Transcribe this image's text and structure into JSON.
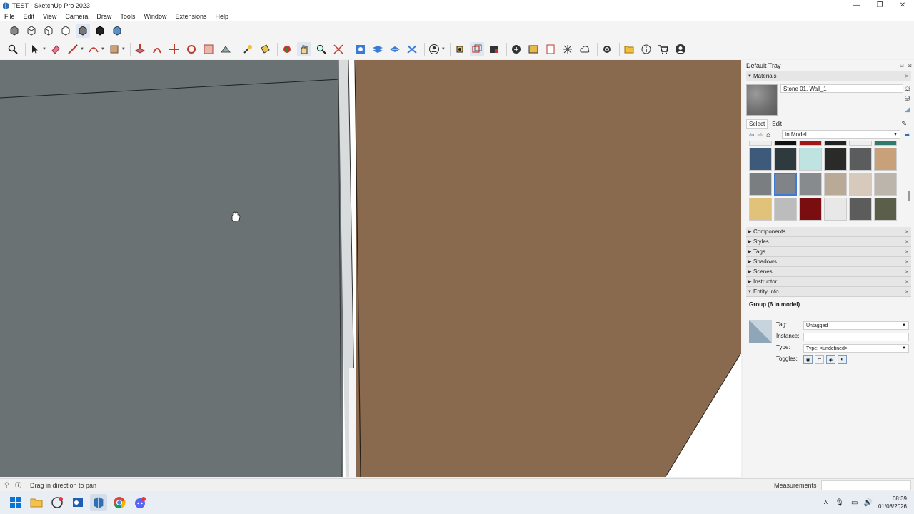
{
  "window": {
    "title": "TEST - SketchUp Pro 2023",
    "controls": [
      "—",
      "❐",
      "✕"
    ]
  },
  "menu": [
    "File",
    "Edit",
    "View",
    "Camera",
    "Draw",
    "Tools",
    "Window",
    "Extensions",
    "Help"
  ],
  "toolbar_top": [
    "iso-view-icon",
    "top-view-icon",
    "front-view-icon",
    "right-view-icon",
    "back-view-icon",
    "left-view-icon",
    "bottom-view-icon"
  ],
  "toolbar_main": [
    "search-icon",
    "select-icon",
    "eraser-icon",
    "line-icon",
    "arc-icon",
    "shapes-icon",
    "push-pull-icon",
    "offset-icon",
    "move-icon",
    "rotate-icon",
    "scale-icon",
    "follow-me-icon",
    "tape-icon",
    "paint-icon",
    "orbit-icon",
    "pan-icon",
    "zoom-icon",
    "zoom-extents-icon",
    "section-icon",
    "layer-icon",
    "xray-icon",
    "solids-icon",
    "warehouse-icon",
    "extension-manager-icon",
    "geo-icon",
    "account-icon"
  ],
  "status": {
    "hint": "Drag in direction to pan",
    "measurements_label": "Measurements"
  },
  "tray": {
    "title": "Default Tray",
    "materials": {
      "header": "Materials",
      "current_name": "Stone 01, Wall_1",
      "tabs": [
        "Select",
        "Edit"
      ],
      "collection": "In Model",
      "swatch_colors": [
        "#3d5a7a",
        "#2e3a3e",
        "#bfe3e0",
        "#2a2a28",
        "#5a5c5e",
        "#c8a07a",
        "#7b7e80",
        "#808488",
        "#888b8e",
        "#b9aa98",
        "#d7c9bb",
        "#bcb5ac",
        "#e1c27a",
        "#bcbcbc",
        "#7a0d10",
        "#e8e8e8",
        "#5c5c5c",
        "#5b5f4a"
      ]
    },
    "panels": [
      "Components",
      "Styles",
      "Tags",
      "Shadows",
      "Scenes",
      "Instructor"
    ],
    "entity_info": {
      "header": "Entity Info",
      "title": "Group (6 in model)",
      "tag_label": "Tag:",
      "tag_value": "Untagged",
      "instance_label": "Instance:",
      "instance_value": "",
      "type_label": "Type:",
      "type_value": "Type: <undefined>",
      "toggles_label": "Toggles:"
    }
  },
  "taskbar": {
    "time": "08:39",
    "date": "01/08/2026"
  },
  "colors": {
    "wall_grey": "#6b7274",
    "wall_brown": "#8a6a4f"
  }
}
